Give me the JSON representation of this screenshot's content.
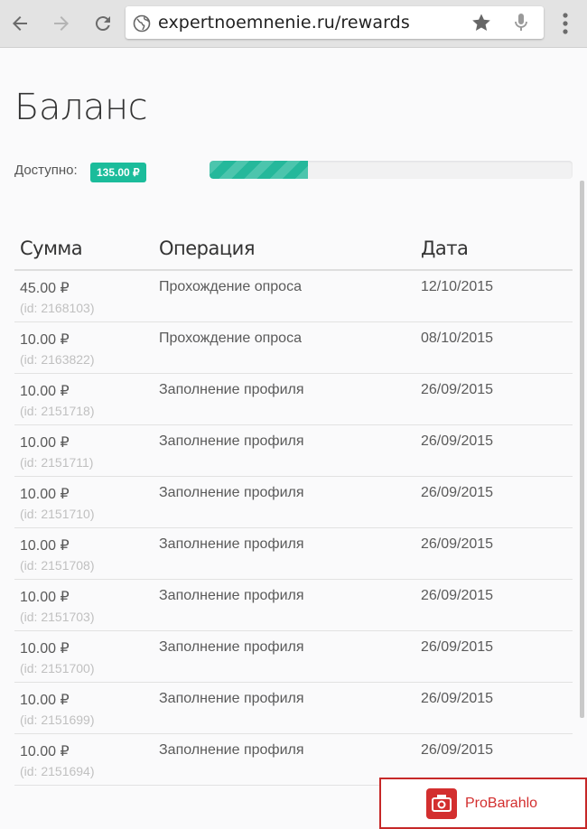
{
  "browser": {
    "url": "expertnoemnenie.ru/rewards",
    "icons": [
      "back-icon",
      "forward-icon",
      "reload-icon",
      "globe-icon",
      "star-icon",
      "mic-icon",
      "menu-icon"
    ]
  },
  "page": {
    "title": "Баланс",
    "available_label": "Доступно:",
    "balance": "135.00 ₽",
    "progress_fraction": 0.27
  },
  "table": {
    "headers": [
      "Сумма",
      "Операция",
      "Дата"
    ],
    "rows": [
      {
        "amount": "45.00 ₽",
        "id": "(id: 2168103)",
        "operation": "Прохождение опроса",
        "date": "12/10/2015"
      },
      {
        "amount": "10.00 ₽",
        "id": "(id: 2163822)",
        "operation": "Прохождение опроса",
        "date": "08/10/2015"
      },
      {
        "amount": "10.00 ₽",
        "id": "(id: 2151718)",
        "operation": "Заполнение профиля",
        "date": "26/09/2015"
      },
      {
        "amount": "10.00 ₽",
        "id": "(id: 2151711)",
        "operation": "Заполнение профиля",
        "date": "26/09/2015"
      },
      {
        "amount": "10.00 ₽",
        "id": "(id: 2151710)",
        "operation": "Заполнение профиля",
        "date": "26/09/2015"
      },
      {
        "amount": "10.00 ₽",
        "id": "(id: 2151708)",
        "operation": "Заполнение профиля",
        "date": "26/09/2015"
      },
      {
        "amount": "10.00 ₽",
        "id": "(id: 2151703)",
        "operation": "Заполнение профиля",
        "date": "26/09/2015"
      },
      {
        "amount": "10.00 ₽",
        "id": "(id: 2151700)",
        "operation": "Заполнение профиля",
        "date": "26/09/2015"
      },
      {
        "amount": "10.00 ₽",
        "id": "(id: 2151699)",
        "operation": "Заполнение профиля",
        "date": "26/09/2015"
      },
      {
        "amount": "10.00 ₽",
        "id": "(id: 2151694)",
        "operation": "Заполнение профиля",
        "date": "26/09/2015"
      }
    ]
  },
  "watermark": {
    "text": "ProBarahlo"
  },
  "colors": {
    "accent": "#1bbc9b",
    "watermark": "#d32f2f"
  }
}
